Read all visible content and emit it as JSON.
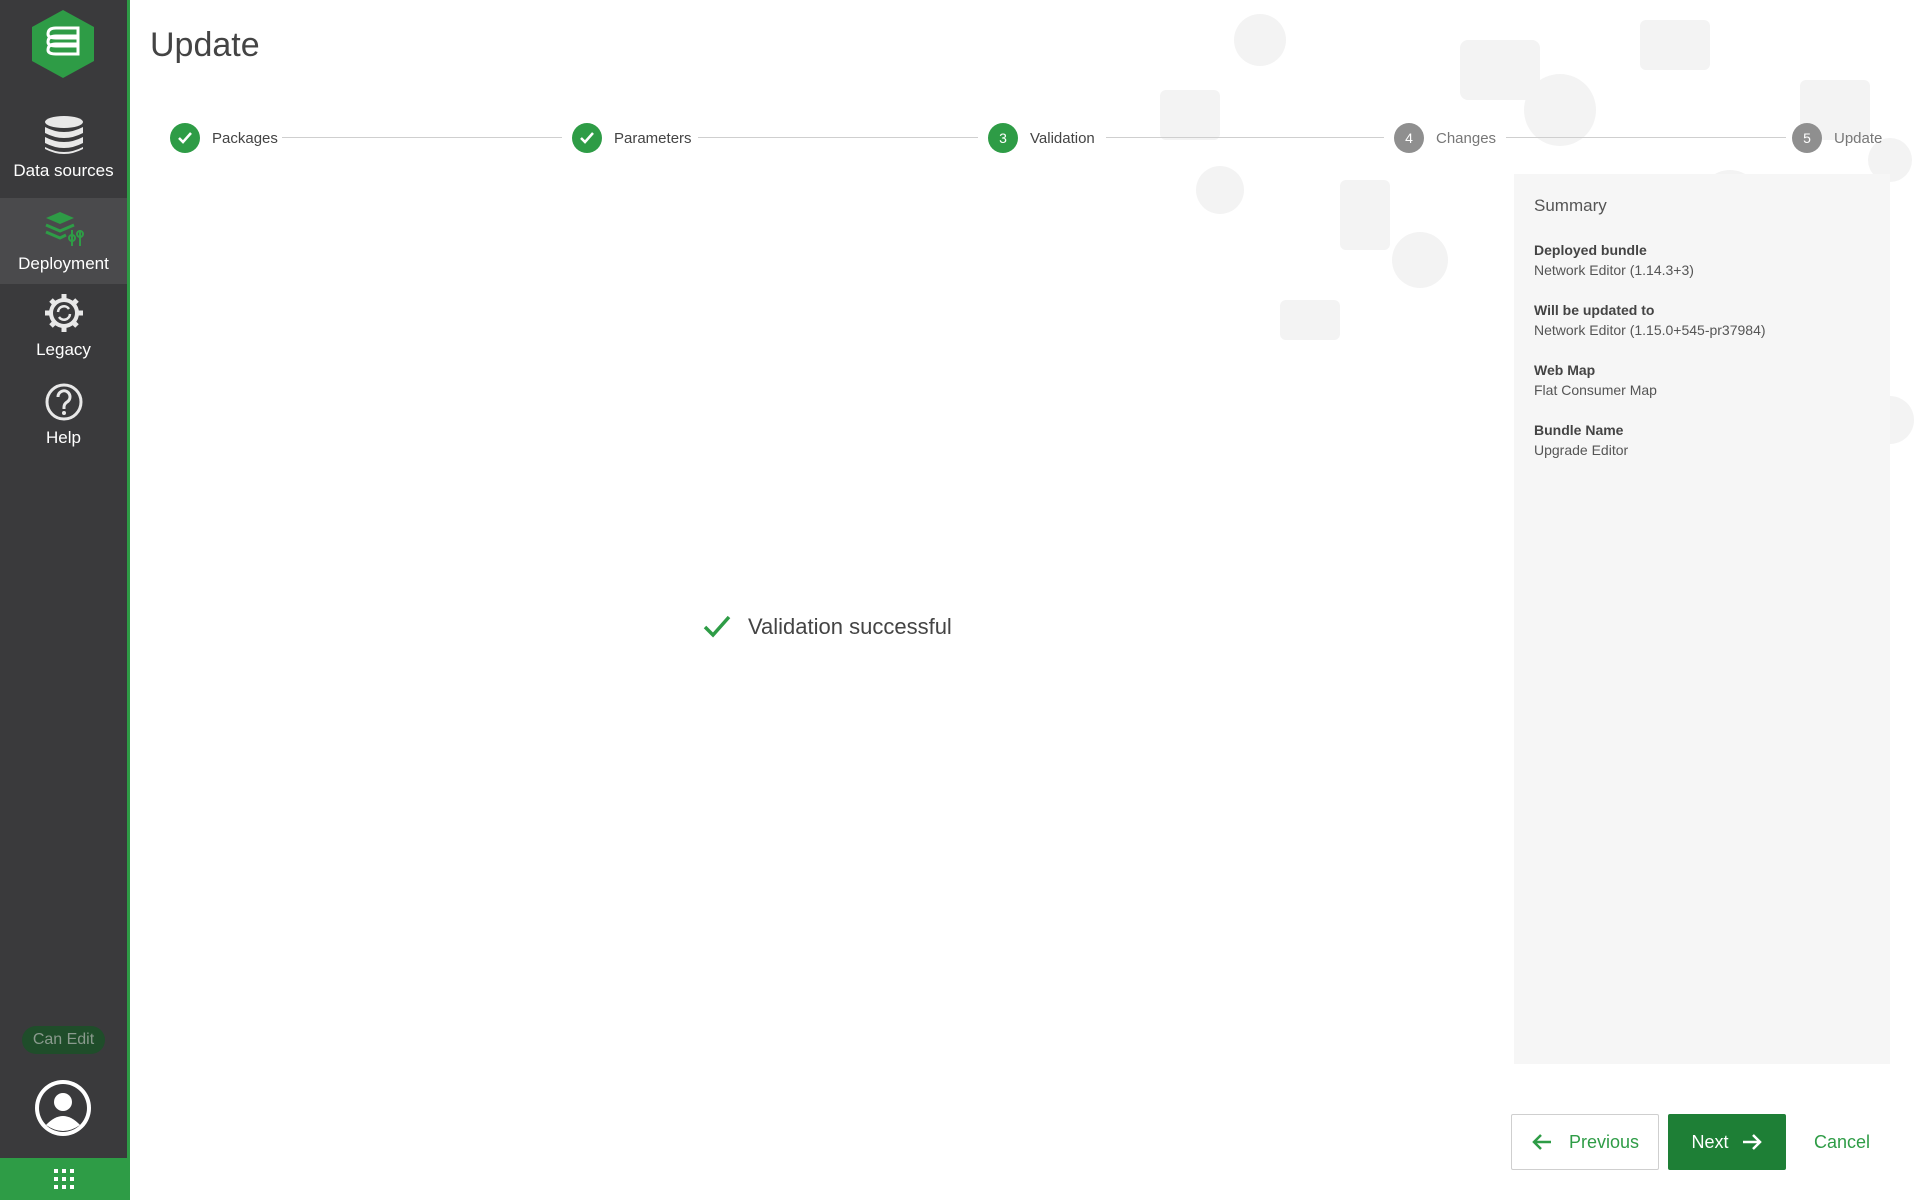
{
  "page": {
    "title": "Update"
  },
  "sidebar": {
    "items": [
      {
        "label": "Data sources",
        "icon": "database-icon",
        "active": false
      },
      {
        "label": "Deployment",
        "icon": "deployment-layers-icon",
        "active": true
      },
      {
        "label": "Legacy",
        "icon": "legacy-gear-icon",
        "active": false
      },
      {
        "label": "Help",
        "icon": "help-circle-icon",
        "active": false
      }
    ],
    "badge": "Can Edit",
    "accent_color": "#2e9c46"
  },
  "stepper": {
    "steps": [
      {
        "label": "Packages",
        "state": "done"
      },
      {
        "label": "Parameters",
        "state": "done"
      },
      {
        "number": "3",
        "label": "Validation",
        "state": "current"
      },
      {
        "number": "4",
        "label": "Changes",
        "state": "pending"
      },
      {
        "number": "5",
        "label": "Update",
        "state": "pending"
      }
    ]
  },
  "validation": {
    "message": "Validation successful"
  },
  "summary": {
    "title": "Summary",
    "items": [
      {
        "key": "Deployed bundle",
        "value": "Network Editor (1.14.3+3)"
      },
      {
        "key": "Will be updated to",
        "value": "Network Editor (1.15.0+545-pr37984)"
      },
      {
        "key": "Web Map",
        "value": "Flat Consumer Map"
      },
      {
        "key": "Bundle Name",
        "value": "Upgrade Editor"
      }
    ]
  },
  "footer": {
    "previous_label": "Previous",
    "next_label": "Next",
    "cancel_label": "Cancel"
  }
}
